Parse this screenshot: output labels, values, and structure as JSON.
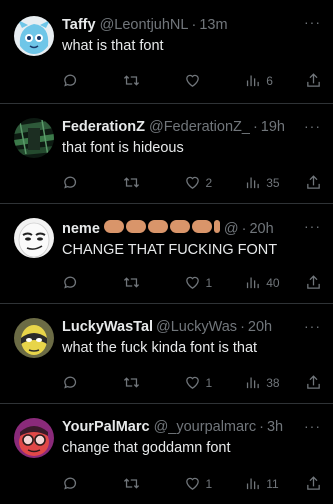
{
  "colors": {
    "background": "#000000",
    "text": "#e7e9ea",
    "muted": "#71767b",
    "divider": "#2f3336"
  },
  "tweets": [
    {
      "name": "Taffy",
      "handle": "@LeontjuhNL",
      "time": "13m",
      "text": "what is that font",
      "replies": "",
      "retweets": "",
      "likes": "",
      "views": "6",
      "avatar": "blue-cartoon-avatar"
    },
    {
      "name": "FederationZ",
      "handle": "@FederationZ_",
      "time": "19h",
      "text": "that font is hideous",
      "replies": "",
      "retweets": "",
      "likes": "2",
      "views": "35",
      "avatar": "green-glitch-avatar"
    },
    {
      "name": "neme",
      "handle": "@",
      "time": "20h",
      "text": "CHANGE THAT FUCKING FONT",
      "replies": "",
      "retweets": "",
      "likes": "1",
      "views": "40",
      "avatar": "smirk-face-avatar",
      "name_emojis": [
        "flexed-biceps",
        "flexed-biceps",
        "flexed-biceps",
        "flexed-biceps",
        "flexed-biceps",
        "flexed-biceps"
      ]
    },
    {
      "name": "LuckyWasTake",
      "handle": "@LuckyWas",
      "time": "20h",
      "text": "what the fuck kinda font is that",
      "replies": "",
      "retweets": "",
      "likes": "1",
      "views": "38",
      "avatar": "yellow-hero-avatar"
    },
    {
      "name": "YourPalMarc",
      "handle": "@_yourpalmarc",
      "time": "3h",
      "text": "change that goddamn font",
      "replies": "",
      "retweets": "",
      "likes": "1",
      "views": "11",
      "avatar": "red-glasses-avatar"
    }
  ],
  "icons": {
    "reply": "reply-icon",
    "retweet": "retweet-icon",
    "like": "heart-icon",
    "views": "views-icon",
    "share": "share-icon",
    "more": "more-icon"
  }
}
